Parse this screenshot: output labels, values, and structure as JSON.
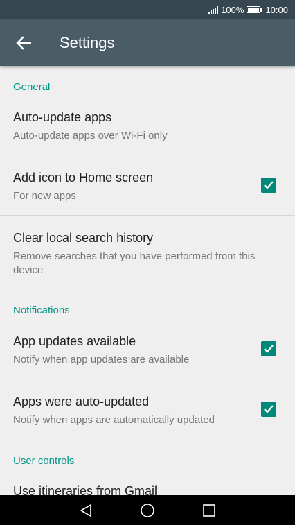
{
  "status_bar": {
    "battery_percent": "100%",
    "time": "10:00",
    "icons": [
      "signal-icon",
      "battery-icon"
    ]
  },
  "app_bar": {
    "title": "Settings",
    "back_icon": "arrow-back-icon"
  },
  "sections": {
    "general": "General",
    "notifications": "Notifications",
    "user_controls": "User controls"
  },
  "items": {
    "auto_update": {
      "title": "Auto-update apps",
      "summary": "Auto-update apps over Wi-Fi only"
    },
    "add_icon": {
      "title": "Add icon to Home screen",
      "summary": "For new apps",
      "checked": true
    },
    "clear_history": {
      "title": "Clear local search history",
      "summary": "Remove searches that you have performed from this device"
    },
    "app_updates": {
      "title": "App updates available",
      "summary": "Notify when app updates are available",
      "checked": true
    },
    "auto_updated": {
      "title": "Apps were auto-updated",
      "summary": "Notify when apps are automatically updated",
      "checked": true
    },
    "itineraries": {
      "title": "Use itineraries from Gmail"
    }
  },
  "nav_bar": {
    "icons": [
      "back-triangle-icon",
      "home-circle-icon",
      "recents-square-icon"
    ]
  },
  "colors": {
    "accent": "#009688",
    "checkbox": "#00897b",
    "app_bar": "#4a5d66",
    "status_bar": "#37474f"
  }
}
